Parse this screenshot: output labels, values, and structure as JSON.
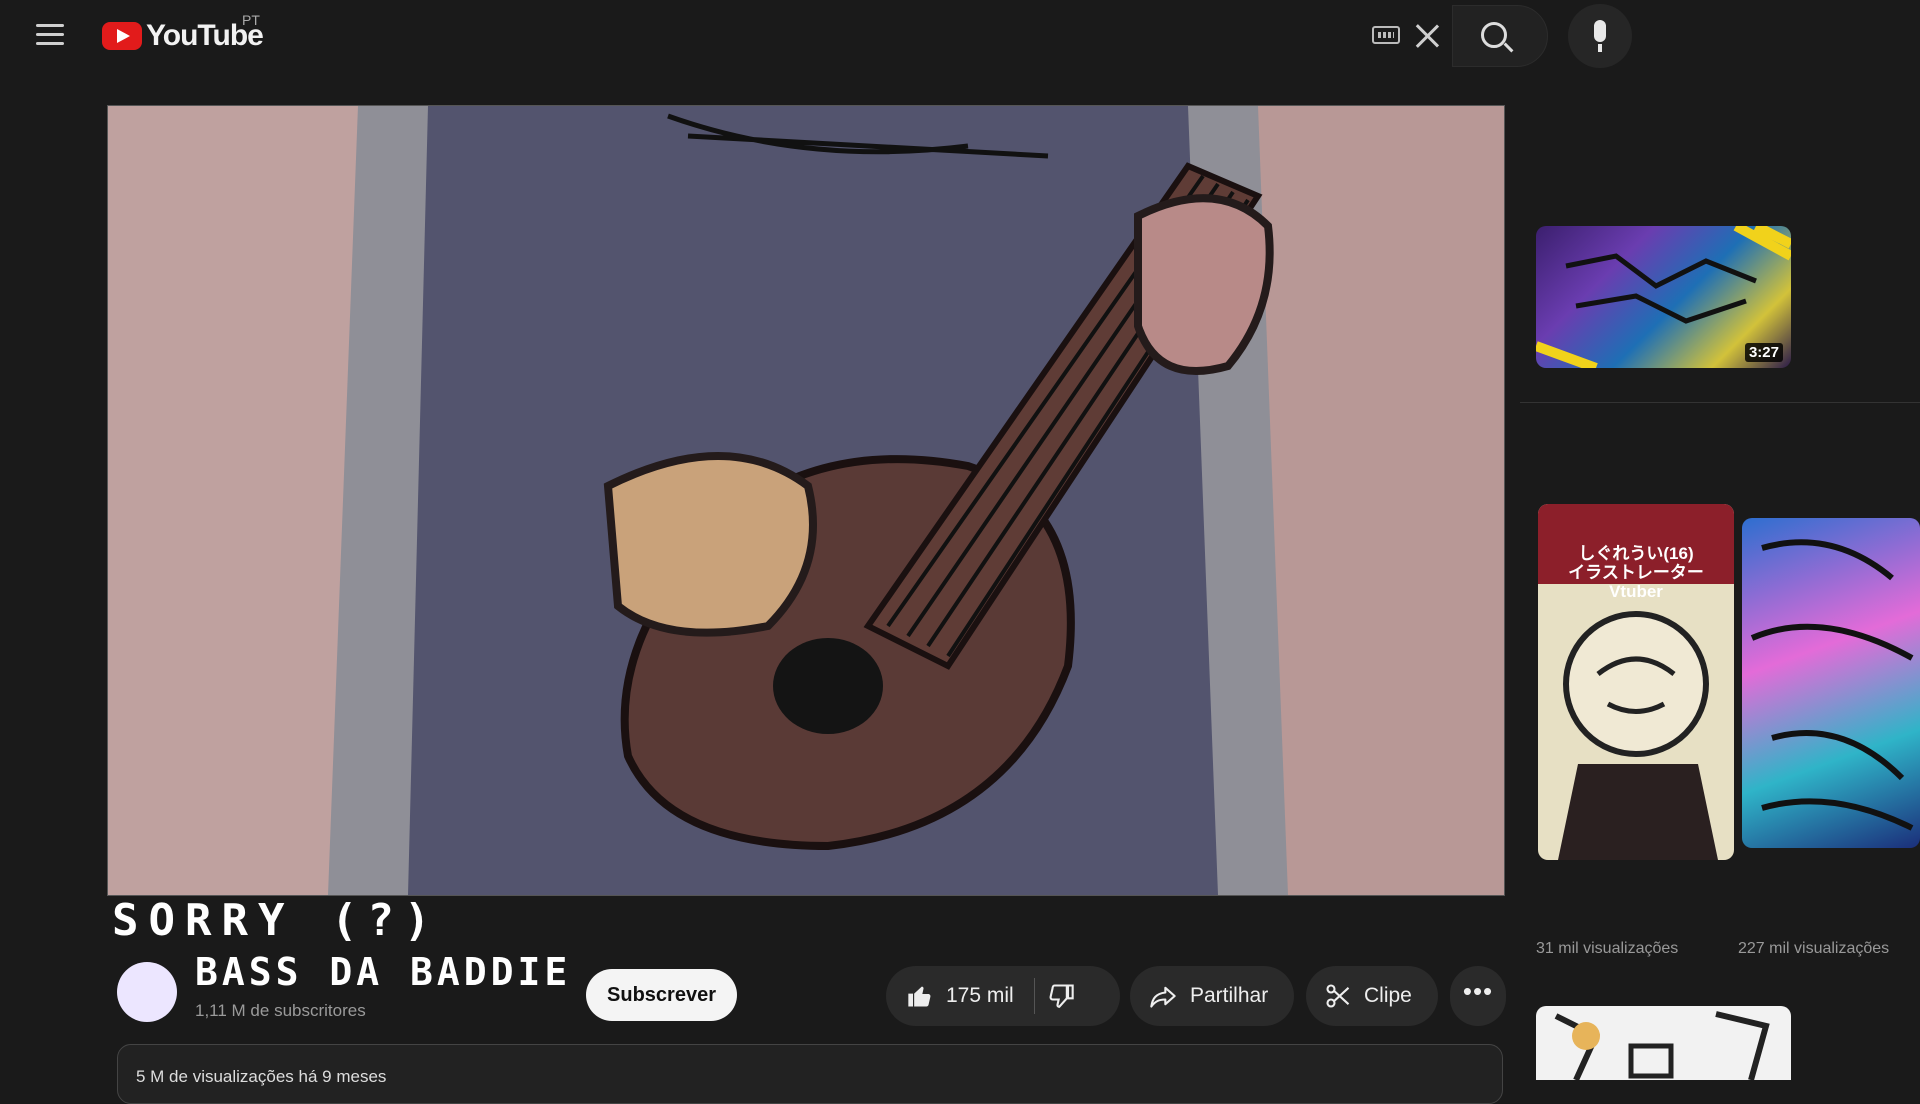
{
  "header": {
    "logo_text": "YouTube",
    "country_code": "PT"
  },
  "video": {
    "title": "SORRY (?)",
    "channel_name": "BASS DA BADDIE",
    "subscribers": "1,11 M de subscritores",
    "subscribe_label": "Subscrever",
    "likes": "175 mil",
    "share_label": "Partilhar",
    "clip_label": "Clipe",
    "description_meta": "5 M de visualizações  há 9 meses"
  },
  "sidebar": {
    "items": [
      {
        "duration": "3:27"
      },
      {
        "thumb_text": "しぐれうい(16)\nイラストレーター\nVtuber",
        "views": "31 mil visualizações"
      },
      {
        "views": "227 mil visualizações"
      }
    ]
  },
  "colors": {
    "logo_red": "#e21b1b",
    "page_bg": "#1a1a1a",
    "pill_bg": "#2a2a2a"
  },
  "icons": [
    "menu-icon",
    "youtube-logo-icon",
    "keyboard-icon",
    "clear-icon",
    "search-icon",
    "mic-icon",
    "thumbs-up-icon",
    "thumbs-down-icon",
    "share-arrow-icon",
    "scissors-icon",
    "more-dots-icon"
  ]
}
